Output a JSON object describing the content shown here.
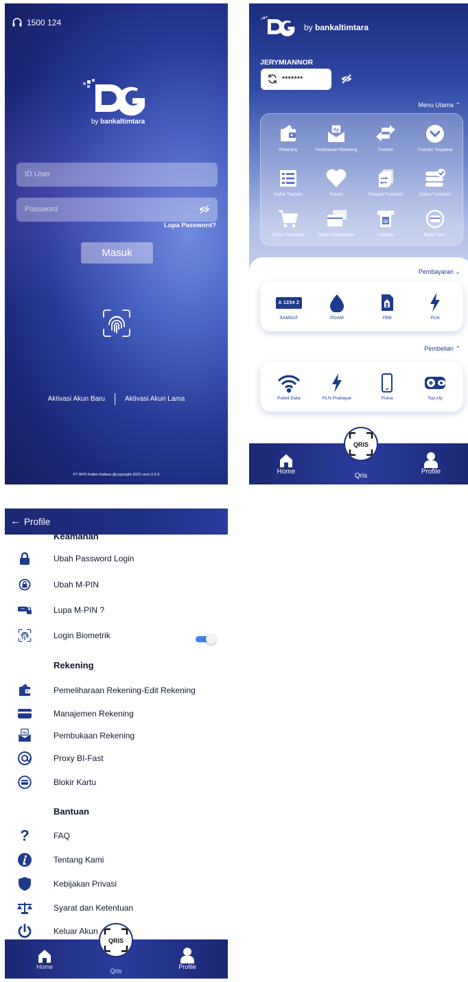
{
  "colors": {
    "navy": "#1b2873",
    "accent_blue": "#1e3a8a",
    "toggle_on": "#3b82f6"
  },
  "login": {
    "hotline": "1500 124",
    "logo_by": "by",
    "logo_bank": "bankaltimtara",
    "userid_placeholder": "ID User",
    "password_placeholder": "Password",
    "forgot_password": "Lupa Password?",
    "login_button": "Masuk",
    "activate_new": "Aktivasi Akun Baru",
    "activate_old": "Aktivasi Akun Lama",
    "copyright": "PT BPD Kaltim Kaltara @copyright 2022 versi 2.6.5"
  },
  "home": {
    "logo_by": "by",
    "logo_bank": "bankaltimtara",
    "username": "JERYMIANNOR",
    "balance_masked": "*******",
    "menu_utama_label": "Menu Utama",
    "menu": [
      {
        "label": "Rekening",
        "icon": "wallet-icon"
      },
      {
        "label": "Pembukaan Rekening",
        "icon": "envelope-rp-icon"
      },
      {
        "label": "Transfer",
        "icon": "transfer-arrows-icon"
      },
      {
        "label": "Transfer Terjadwal",
        "icon": "chevron-circle-icon"
      },
      {
        "label": "Daftar Transfer",
        "icon": "list-icon"
      },
      {
        "label": "Favorit",
        "icon": "heart-icon"
      },
      {
        "label": "Riwayat Transaksi",
        "icon": "history-icon"
      },
      {
        "label": "Status Transaksi",
        "icon": "status-icon"
      },
      {
        "label": "Daftar Pembelian",
        "icon": "cart-icon"
      },
      {
        "label": "Daftar Pembayaran",
        "icon": "payment-list-icon"
      },
      {
        "label": "Cardless",
        "icon": "atm-icon"
      },
      {
        "label": "Blokir Kartu",
        "icon": "block-card-icon"
      }
    ],
    "pembayaran_label": "Pembayaran",
    "pembayaran": [
      {
        "label": "SAMSAT",
        "icon": "plate-icon",
        "plate": "A 1234 Z"
      },
      {
        "label": "PDAM",
        "icon": "water-drop-icon"
      },
      {
        "label": "PBB",
        "icon": "building-doc-icon"
      },
      {
        "label": "PLN",
        "icon": "lightning-icon"
      }
    ],
    "pembelian_label": "Pembelian",
    "pembelian": [
      {
        "label": "Paket Data",
        "icon": "wifi-icon"
      },
      {
        "label": "PLN Prabayar",
        "icon": "lightning-icon"
      },
      {
        "label": "Pulsa",
        "icon": "phone-icon"
      },
      {
        "label": "Top-Up",
        "icon": "topup-wallet-icon"
      }
    ]
  },
  "nav": {
    "home": "Home",
    "qris": "Qris",
    "profile": "Profile",
    "qris_logo": "QRIS"
  },
  "profile": {
    "back_arrow": "←",
    "title": "Profile",
    "keamanan_label": "Keamanan",
    "keamanan": [
      {
        "label": "Ubah Password Login",
        "icon": "lock-icon"
      },
      {
        "label": "Ubah M-PIN",
        "icon": "pin-lock-icon"
      },
      {
        "label": "Lupa M-PIN ?",
        "icon": "pin-key-icon"
      },
      {
        "label": "Login Biometrik",
        "icon": "fingerprint-icon"
      }
    ],
    "biometric_enabled": true,
    "rekening_label": "Rekening",
    "rekening": [
      {
        "label": "Pemeliharaan Rekening-Edit Rekening",
        "icon": "wallet-icon"
      },
      {
        "label": "Manajemen Rekening",
        "icon": "card-icon"
      },
      {
        "label": "Pembukaan Rekening",
        "icon": "envelope-rp-icon"
      },
      {
        "label": "Proxy BI-Fast",
        "icon": "at-sign-icon"
      },
      {
        "label": "Blokir Kartu",
        "icon": "block-card-icon"
      }
    ],
    "bantuan_label": "Bantuan",
    "bantuan": [
      {
        "label": "FAQ",
        "icon": "question-icon"
      },
      {
        "label": "Tentang Kami",
        "icon": "info-icon"
      },
      {
        "label": "Kebijakan Privasi",
        "icon": "shield-icon"
      },
      {
        "label": "Syarat dan Ketentuan",
        "icon": "scales-icon"
      },
      {
        "label": "Keluar Akun",
        "icon": "power-icon"
      }
    ]
  }
}
